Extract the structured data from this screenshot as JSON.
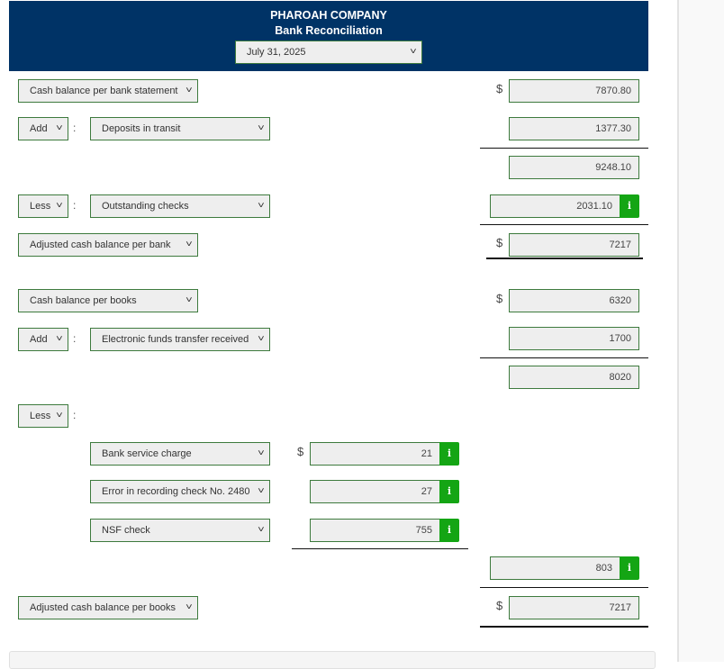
{
  "header": {
    "company": "PHAROAH COMPANY",
    "title": "Bank Reconciliation",
    "date_select": "July 31, 2025"
  },
  "currency_symbol": "$",
  "bank": {
    "start_label": "Cash balance per bank statement",
    "start_amount": "7870.80",
    "add_op": "Add",
    "add_item": "Deposits in transit",
    "add_amount": "1377.30",
    "subtotal": "9248.10",
    "less_op": "Less",
    "less_item": "Outstanding checks",
    "less_amount": "2031.10",
    "adjusted_label": "Adjusted cash balance per bank",
    "adjusted_amount": "7217"
  },
  "books": {
    "start_label": "Cash balance per books",
    "start_amount": "6320",
    "add_op": "Add",
    "add_item": "Electronic funds transfer received",
    "add_amount": "1700",
    "subtotal": "8020",
    "less_op": "Less",
    "less_items": [
      {
        "label": "Bank service charge",
        "amount": "21"
      },
      {
        "label": "Error in recording check No. 2480",
        "amount": "27"
      },
      {
        "label": "NSF check",
        "amount": "755"
      }
    ],
    "less_total": "803",
    "adjusted_label": "Adjusted cash balance per books",
    "adjusted_amount": "7217"
  },
  "icons": {
    "chevron": "⌄",
    "info": "i"
  }
}
